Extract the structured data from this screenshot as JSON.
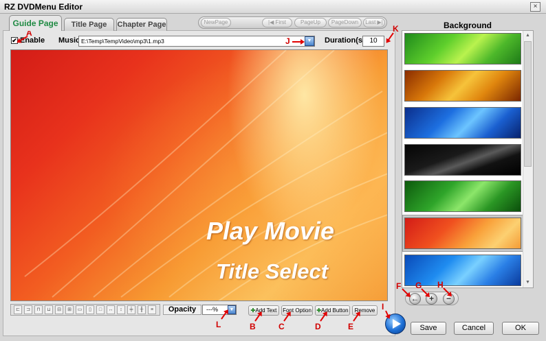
{
  "window": {
    "title": "RZ DVDMenu Editor",
    "close_glyph": "×"
  },
  "tabs": [
    {
      "label": "Guide Page",
      "active": true
    },
    {
      "label": "Title Page",
      "active": false
    },
    {
      "label": "Chapter Page",
      "active": false
    }
  ],
  "nav": {
    "new_page": "NewPage",
    "first": "First",
    "page_up": "PageUp",
    "page_down": "PageDown",
    "last": "Last"
  },
  "enable": {
    "label": "Enable",
    "checked": true,
    "check_glyph": "✔"
  },
  "music": {
    "label": "Music",
    "path": "E:\\Temp\\TempVideo\\mp3\\1.mp3"
  },
  "duration": {
    "label": "Duration(s)",
    "value": "10"
  },
  "canvas": {
    "play_movie": "Play Movie",
    "title_select": "Title Select"
  },
  "bottom_bar": {
    "opacity_label": "Opacity",
    "opacity_value": "---%",
    "add_text": "Add Text",
    "font_option": "Font Option",
    "add_button": "Add Button",
    "remove": "Remove"
  },
  "buttons": {
    "save": "Save",
    "cancel": "Cancel",
    "ok": "OK"
  },
  "background": {
    "title": "Background",
    "selected_index": 5
  },
  "background_controls": {
    "back": "←",
    "add": "+",
    "remove": "−"
  },
  "annotations": {
    "A": "A",
    "B": "B",
    "C": "C",
    "D": "D",
    "E": "E",
    "F": "F",
    "G": "G",
    "H": "H",
    "I": "I",
    "J": "J",
    "K": "K",
    "L": "L"
  },
  "icons": {
    "align_tools": [
      "align-left-icon",
      "align-center-icon",
      "align-right-icon",
      "align-top-icon",
      "align-middle-icon",
      "align-bottom-icon",
      "same-width-icon",
      "same-height-icon",
      "same-size-icon",
      "space-horizontal-icon",
      "space-vertical-icon",
      "center-horizontal-icon",
      "center-vertical-icon",
      "distribute-icon"
    ],
    "play": "play-icon"
  },
  "colors": {
    "active_tab": "#1f8a43",
    "annotation": "#d00000",
    "play_button": "#1c6fd6"
  }
}
